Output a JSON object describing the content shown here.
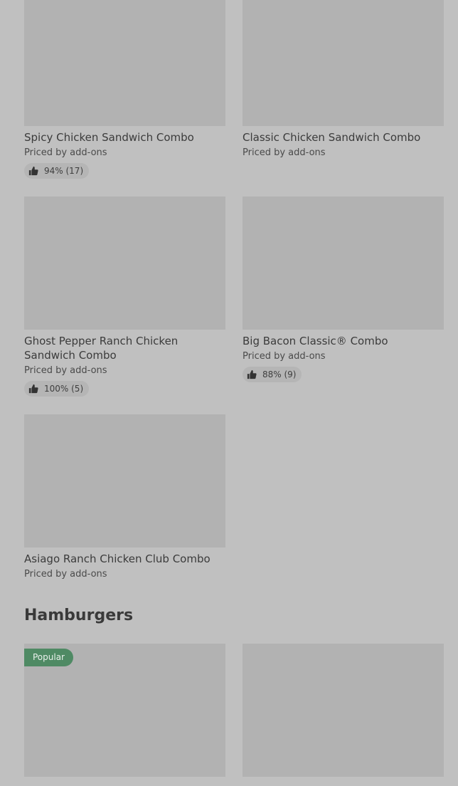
{
  "combos": [
    {
      "title": "Spicy Chicken Sandwich Combo",
      "price": "Priced by add-ons",
      "rating": "94% (17)"
    },
    {
      "title": "Classic Chicken Sandwich Combo",
      "price": "Priced by add-ons",
      "rating": null
    },
    {
      "title": "Ghost Pepper Ranch Chicken Sandwich Combo",
      "price": "Priced by add-ons",
      "rating": "100% (5)"
    },
    {
      "title": "Big Bacon Classic® Combo",
      "price": "Priced by add-ons",
      "rating": "88% (9)"
    },
    {
      "title": "Asiago Ranch Chicken Club Combo",
      "price": "Priced by add-ons",
      "rating": null
    }
  ],
  "hamburgers": {
    "section_title": "Hamburgers",
    "cards": [
      {
        "badge": "Popular"
      },
      {}
    ]
  }
}
